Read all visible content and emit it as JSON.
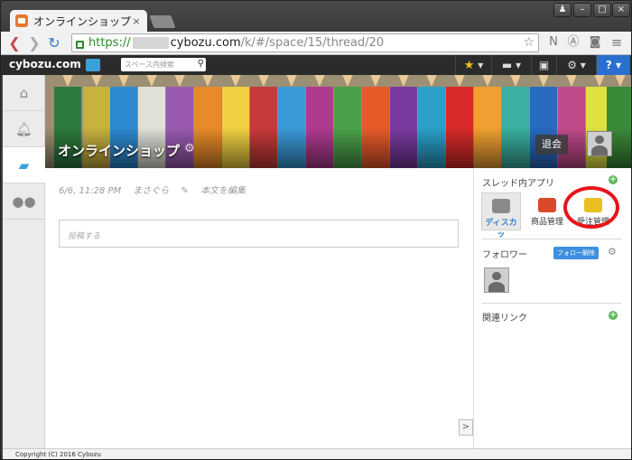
{
  "browser": {
    "tab_title": "オンラインショップ",
    "tab_close": "×",
    "url_scheme": "https://",
    "url_host": "cybozu.com",
    "url_path": "/k/#/space/15/thread/20",
    "window_controls": [
      "user-icon",
      "minimize-icon",
      "maximize-icon",
      "close-icon"
    ]
  },
  "app_header": {
    "logo": "cybozu.com",
    "search_placeholder": "スペース内検索",
    "help_label": "?"
  },
  "sidebar": {
    "items": [
      {
        "icon": "home-icon"
      },
      {
        "icon": "bell-icon"
      },
      {
        "icon": "chat-icon",
        "active": true
      },
      {
        "icon": "people-icon"
      }
    ]
  },
  "banner": {
    "title": "オンラインショップ",
    "leave_label": "退会"
  },
  "thread": {
    "timestamp": "6/6, 11:28 PM",
    "author": "まさぐら",
    "edit_label": "本文を編集",
    "post_placeholder": "投稿する",
    "expand_label": ">"
  },
  "right_panel": {
    "apps_heading": "スレッド内アプリ",
    "apps": [
      {
        "label": "ディスカッ",
        "icon": "discussion-icon",
        "selected": true
      },
      {
        "label": "商品管理",
        "icon": "product-icon",
        "selected": false
      },
      {
        "label": "受注管理",
        "icon": "order-icon",
        "selected": false
      }
    ],
    "followers_heading": "フォロワー",
    "unfollow_label": "フォロー解除",
    "related_links_heading": "関連リンク"
  },
  "footer": {
    "copyright": "Copyright (C) 2016 Cybozu"
  },
  "colors": {
    "accent_blue": "#3aa0d8",
    "highlight_red": "#e8141b",
    "plus_green": "#5cb85c"
  }
}
